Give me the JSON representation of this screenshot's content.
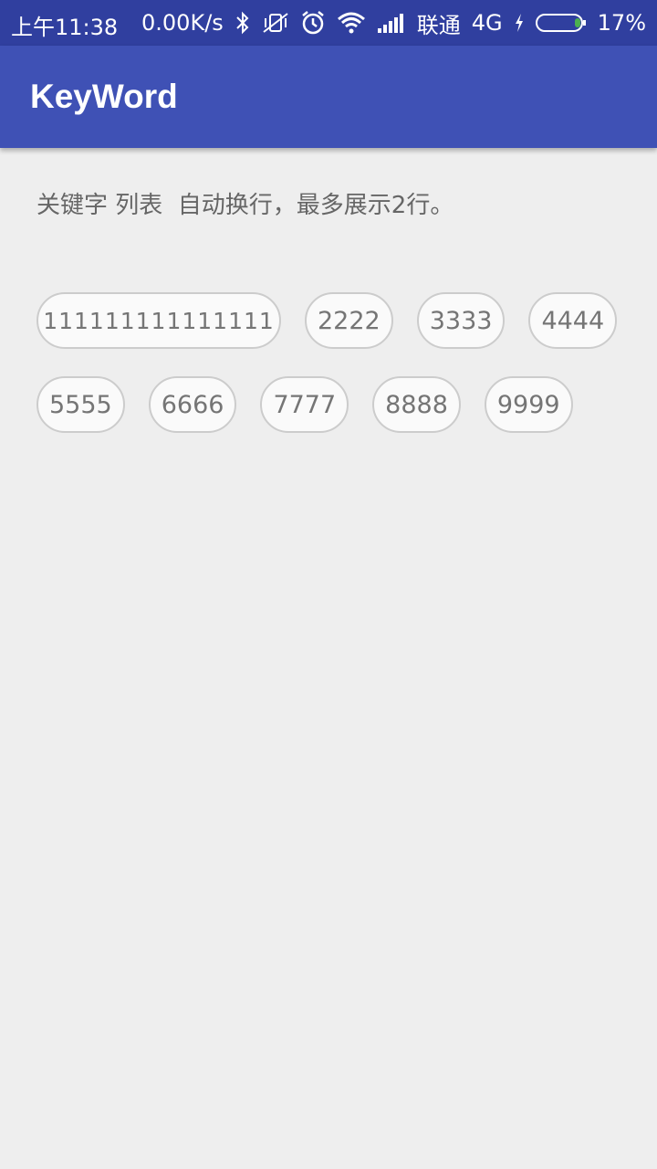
{
  "status_bar": {
    "time": "上午11:38",
    "speed": "0.00K/s",
    "carrier": "联通",
    "network": "4G",
    "battery": "17%",
    "icons": [
      "bluetooth-icon",
      "vibrate-off-icon",
      "alarm-icon",
      "wifi-icon",
      "signal-icon",
      "charging-icon",
      "battery-icon"
    ]
  },
  "toolbar": {
    "title": "KeyWord"
  },
  "description": "关键字 列表  自动换行，最多展示2行。",
  "keywords": {
    "row1": [
      "111111111111111",
      "2222",
      "3333",
      "4444"
    ],
    "row2": [
      "5555",
      "6666",
      "7777",
      "8888",
      "9999"
    ]
  },
  "colors": {
    "status_bar": "#303f9f",
    "toolbar": "#3f51b5",
    "background": "#eeeeee"
  }
}
